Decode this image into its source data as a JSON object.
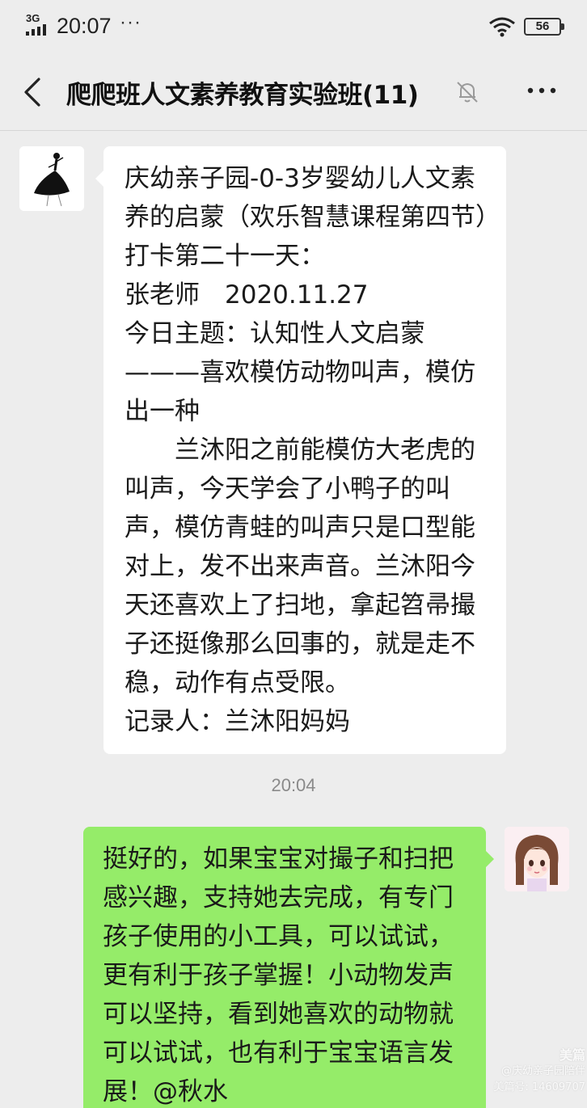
{
  "status_bar": {
    "network": "3G",
    "time": "20:07",
    "more_indicator": "···",
    "battery": "56",
    "icons": [
      "signal-icon",
      "wifi-icon",
      "battery-icon"
    ]
  },
  "nav": {
    "title": "爬爬班人文素养教育实验班(11)",
    "back_icon": "chevron-left-icon",
    "mute_icon": "bell-muted-icon",
    "more_icon": "more-dots-icon"
  },
  "messages": [
    {
      "side": "incoming",
      "avatar": "dancer-silhouette-avatar",
      "text": "庆幼亲子园-0-3岁婴幼儿人文素养的启蒙（欢乐智慧课程第四节）打卡第二十一天：\n张老师　2020.11.27\n今日主题：认知性人文启蒙———喜欢模仿动物叫声，模仿出一种\n　　兰沐阳之前能模仿大老虎的叫声，今天学会了小鸭子的叫声，模仿青蛙的叫声只是口型能对上，发不出来声音。兰沐阳今天还喜欢上了扫地，拿起笤帚撮子还挺像那么回事的，就是走不稳，动作有点受限。\n记录人：兰沐阳妈妈"
    },
    {
      "side": "timestamp",
      "text": "20:04"
    },
    {
      "side": "outgoing",
      "avatar": "cartoon-girl-avatar",
      "text": "挺好的，如果宝宝对撮子和扫把感兴趣，支持她去完成，有专门孩子使用的小工具，可以试试，更有利于孩子掌握！小动物发声可以坚持，看到她喜欢的动物就可以试试，也有利于宝宝语言发展！@秋水"
    }
  ],
  "watermark": {
    "brand": "美篇",
    "line1": "@庆幼亲子园陪伴",
    "line2": "美篇号: 14609707"
  },
  "colors": {
    "background": "#ededed",
    "incoming_bubble": "#ffffff",
    "outgoing_bubble": "#95ec69"
  }
}
